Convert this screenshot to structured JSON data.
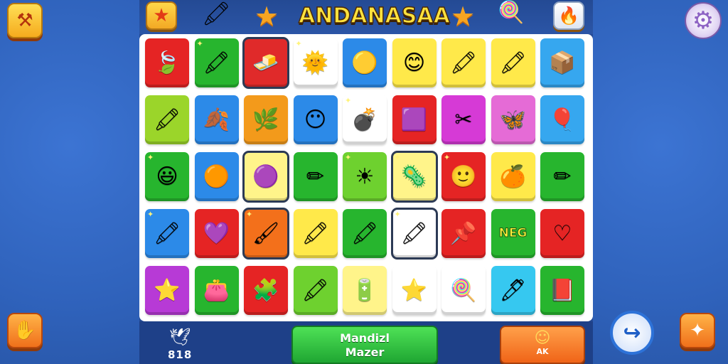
{
  "header": {
    "title": "ANDANASAA",
    "icons": [
      "star-icon",
      "crayon-icon",
      "star-icon",
      "star-icon",
      "lollipop-icon",
      "trophy-icon"
    ]
  },
  "corner_buttons": {
    "top_left": "tools-icon",
    "top_right": "gear-icon",
    "bottom_left": "hand-icon",
    "bottom_right": "puzzle-icon",
    "share": "share-icon"
  },
  "board": {
    "tiles": [
      {
        "bg": "#e52424",
        "glyph": "🍃",
        "name": "leaf"
      },
      {
        "bg": "#27b52e",
        "glyph": "🖍",
        "name": "purple-crayon",
        "spark": true
      },
      {
        "bg": "#e02a2a",
        "glyph": "🧈",
        "name": "eraser",
        "sel": true
      },
      {
        "bg": "#ffffff",
        "glyph": "🌞",
        "name": "sun-face",
        "spark": true
      },
      {
        "bg": "#2c8ae8",
        "glyph": "🟡",
        "name": "gold-ball"
      },
      {
        "bg": "#ffe94a",
        "glyph": "😊",
        "name": "smile-face"
      },
      {
        "bg": "#ffe94a",
        "glyph": "🖍",
        "name": "blue-crayon"
      },
      {
        "bg": "#ffe94a",
        "glyph": "🖍",
        "name": "violet-crayon"
      },
      {
        "bg": "#36a7ef",
        "glyph": "📦",
        "name": "box"
      },
      {
        "bg": "#9bd52a",
        "glyph": "🖍",
        "name": "yellow-crayon"
      },
      {
        "bg": "#2c8ae8",
        "glyph": "🍂",
        "name": "red-leaf"
      },
      {
        "bg": "#f39a1b",
        "glyph": "🌿",
        "name": "sprig"
      },
      {
        "bg": "#2c8ae8",
        "glyph": "😶",
        "name": "blue-face"
      },
      {
        "bg": "#ffffff",
        "glyph": "💣",
        "name": "bomb",
        "spark": true
      },
      {
        "bg": "#e52424",
        "glyph": "🟪",
        "name": "purple-gem"
      },
      {
        "bg": "#d63ad6",
        "glyph": "✂",
        "name": "scissors"
      },
      {
        "bg": "#e56bd6",
        "glyph": "🦋",
        "name": "butterfly"
      },
      {
        "bg": "#36a7ef",
        "glyph": "🎈",
        "name": "balloon"
      },
      {
        "bg": "#27b52e",
        "glyph": "😃",
        "name": "orange-face",
        "spark": true
      },
      {
        "bg": "#2c8ae8",
        "glyph": "🟠",
        "name": "orange-ball"
      },
      {
        "bg": "#fff48a",
        "glyph": "🟣",
        "name": "purple-button",
        "sel": true
      },
      {
        "bg": "#27b52e",
        "glyph": "✏",
        "name": "pencil"
      },
      {
        "bg": "#6ed12f",
        "glyph": "☀",
        "name": "sun",
        "spark": true
      },
      {
        "bg": "#fff48a",
        "glyph": "🦠",
        "name": "green-germ",
        "spark": true,
        "sel": true
      },
      {
        "bg": "#e52424",
        "glyph": "🙂",
        "name": "yellow-face",
        "spark": true
      },
      {
        "bg": "#ffe94a",
        "glyph": "🍊",
        "name": "orange-face-2"
      },
      {
        "bg": "#27b52e",
        "glyph": "✏",
        "name": "pencil-2"
      },
      {
        "bg": "#2c8ae8",
        "glyph": "🖍",
        "name": "blue-crayon-2",
        "spark": true
      },
      {
        "bg": "#e52424",
        "glyph": "💜",
        "name": "heart"
      },
      {
        "bg": "#f3701b",
        "glyph": "🖌",
        "name": "brush",
        "spark": true,
        "sel": true
      },
      {
        "bg": "#ffe94a",
        "glyph": "🖍",
        "name": "blue-crayon-3"
      },
      {
        "bg": "#27b52e",
        "glyph": "🖍",
        "name": "yellow-crayon-2"
      },
      {
        "bg": "#ffffff",
        "glyph": "🖍",
        "name": "violet-crayon-2",
        "spark": true,
        "sel": true
      },
      {
        "bg": "#e52424",
        "glyph": "📌",
        "name": "pin"
      },
      {
        "bg": "#27b52e",
        "glyph": "",
        "name": "text-tile",
        "text": "NEG"
      },
      {
        "bg": "#e52424",
        "glyph": "♡",
        "name": "white-heart"
      },
      {
        "bg": "#b73ad6",
        "glyph": "⭐",
        "name": "yellow-star"
      },
      {
        "bg": "#27b52e",
        "glyph": "👛",
        "name": "purse"
      },
      {
        "bg": "#e52424",
        "glyph": "🧩",
        "name": "puzzle"
      },
      {
        "bg": "#6ed12f",
        "glyph": "🖍",
        "name": "orange-crayon"
      },
      {
        "bg": "#fff48a",
        "glyph": "🔋",
        "name": "green-capsule"
      },
      {
        "bg": "#ffffff",
        "glyph": "⭐",
        "name": "gold-star"
      },
      {
        "bg": "#ffffff",
        "glyph": "🍭",
        "name": "lollipop"
      },
      {
        "bg": "#36c8f0",
        "glyph": "🖊",
        "name": "marker"
      },
      {
        "bg": "#27b52e",
        "glyph": "📕",
        "name": "book"
      }
    ]
  },
  "bottom": {
    "score": "818",
    "green_button_line1": "Mandizl",
    "green_button_line2": "Mazer",
    "orange_button_label": "AK"
  }
}
